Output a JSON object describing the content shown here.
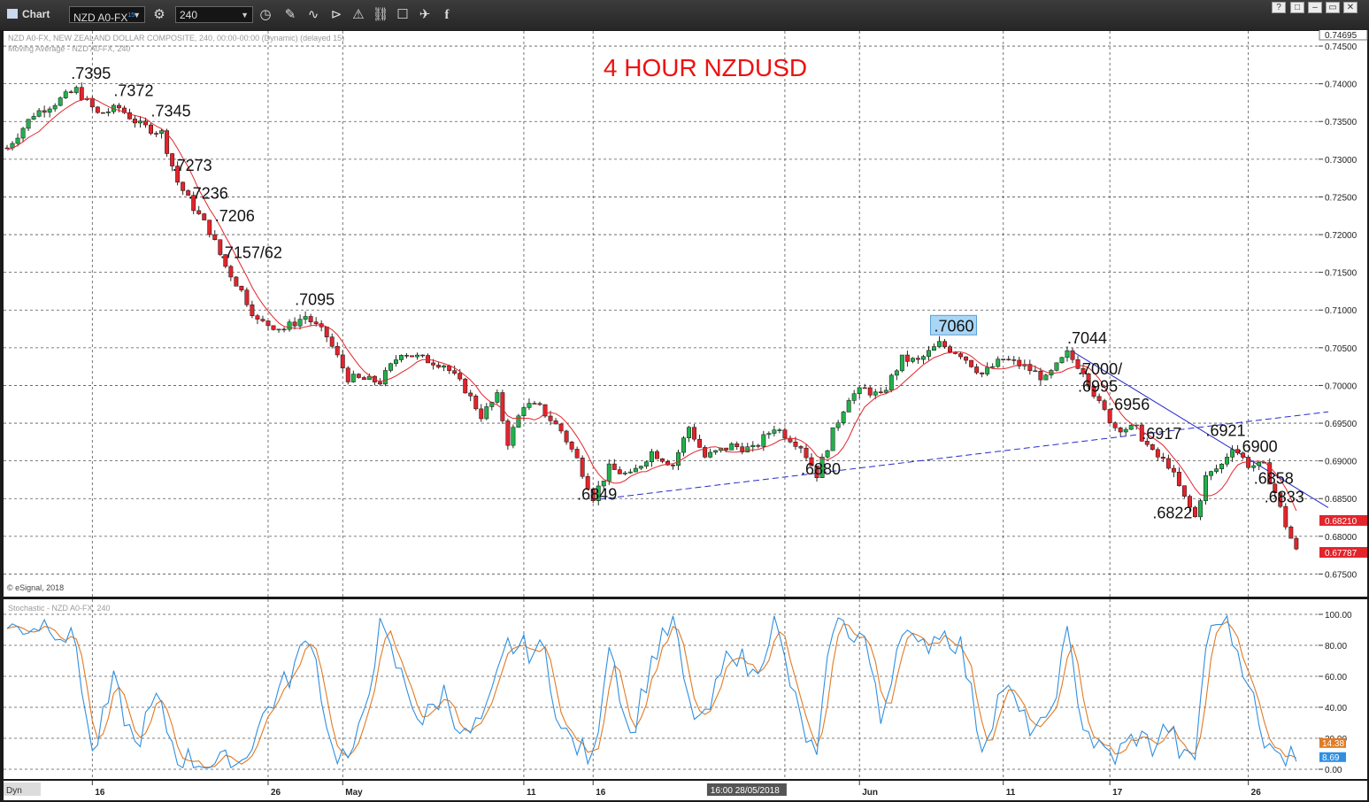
{
  "toolbar": {
    "app_label": "Chart",
    "symbol": "NZD A0-FX",
    "symbol_superscript": "15",
    "interval": "240",
    "window_buttons": [
      "?",
      "□",
      "–",
      "▭",
      "✕"
    ]
  },
  "colors": {
    "background": "#ffffff",
    "up_candle": "#22b14c",
    "down_candle": "#e2242b",
    "moving_average": "#e2242b",
    "trendline": "#2a2ad0",
    "stoch_k": "#2f8fe0",
    "stoch_d": "#e07b26",
    "title": "#ee1111",
    "highlight_box": "#a9d6f5"
  },
  "chart_data": [
    {
      "type": "candlestick",
      "title": "4 HOUR NZDUSD",
      "header_lines": [
        "NZD A0-FX, NEW ZEALAND DOLLAR COMPOSITE, 240, 00:00-00:00 (Dynamic) (delayed 15)",
        "Moving Average - NZD A0-FX, 240"
      ],
      "watermark": "© eSignal, 2018",
      "ylim": [
        0.672,
        0.747
      ],
      "y_ticks": [
        "0.74500",
        "0.74000",
        "0.73500",
        "0.73000",
        "0.72500",
        "0.72000",
        "0.71500",
        "0.71000",
        "0.70500",
        "0.70000",
        "0.69500",
        "0.69000",
        "0.68500",
        "0.68000",
        "0.67500"
      ],
      "price_tags": [
        {
          "label": "0.74695",
          "value": 0.74695,
          "style": "top"
        },
        {
          "label": "0.68210",
          "value": 0.6821,
          "style": "red"
        },
        {
          "label": "0.67787",
          "value": 0.67787,
          "style": "red"
        }
      ],
      "x_ticks": [
        {
          "label": "16",
          "index": 16
        },
        {
          "label": "26",
          "index": 49
        },
        {
          "label": "May",
          "index": 63
        },
        {
          "label": "11",
          "index": 97
        },
        {
          "label": "16",
          "index": 110
        },
        {
          "label": "Jun",
          "index": 160
        },
        {
          "label": "11",
          "index": 187
        },
        {
          "label": "17",
          "index": 207
        },
        {
          "label": "26",
          "index": 233
        }
      ],
      "x_tick_right": {
        "label": "16:00 28/05/2018",
        "index": 146
      },
      "n_bars": 242,
      "waypoints": [
        [
          0,
          0.7315
        ],
        [
          5,
          0.736
        ],
        [
          9,
          0.7375
        ],
        [
          13,
          0.7392
        ],
        [
          17,
          0.736
        ],
        [
          21,
          0.7368
        ],
        [
          25,
          0.7345
        ],
        [
          29,
          0.7335
        ],
        [
          32,
          0.727
        ],
        [
          35,
          0.7236
        ],
        [
          38,
          0.7205
        ],
        [
          41,
          0.7158
        ],
        [
          44,
          0.7125
        ],
        [
          47,
          0.7085
        ],
        [
          52,
          0.7075
        ],
        [
          56,
          0.7092
        ],
        [
          60,
          0.7065
        ],
        [
          64,
          0.701
        ],
        [
          70,
          0.7005
        ],
        [
          74,
          0.7045
        ],
        [
          78,
          0.7035
        ],
        [
          82,
          0.7028
        ],
        [
          86,
          0.6995
        ],
        [
          89,
          0.696
        ],
        [
          92,
          0.6985
        ],
        [
          94,
          0.6925
        ],
        [
          97,
          0.6975
        ],
        [
          100,
          0.697
        ],
        [
          104,
          0.694
        ],
        [
          107,
          0.6902
        ],
        [
          110,
          0.6852
        ],
        [
          113,
          0.689
        ],
        [
          117,
          0.688
        ],
        [
          121,
          0.6912
        ],
        [
          125,
          0.6895
        ],
        [
          128,
          0.6945
        ],
        [
          131,
          0.6905
        ],
        [
          136,
          0.692
        ],
        [
          140,
          0.6915
        ],
        [
          144,
          0.6945
        ],
        [
          149,
          0.692
        ],
        [
          152,
          0.6882
        ],
        [
          155,
          0.6938
        ],
        [
          158,
          0.6985
        ],
        [
          161,
          0.6995
        ],
        [
          164,
          0.6985
        ],
        [
          168,
          0.7035
        ],
        [
          171,
          0.7032
        ],
        [
          175,
          0.7055
        ],
        [
          179,
          0.7042
        ],
        [
          183,
          0.7015
        ],
        [
          187,
          0.7035
        ],
        [
          191,
          0.7025
        ],
        [
          195,
          0.7008
        ],
        [
          199,
          0.7042
        ],
        [
          202,
          0.702
        ],
        [
          205,
          0.6975
        ],
        [
          208,
          0.6945
        ],
        [
          212,
          0.6942
        ],
        [
          215,
          0.691
        ],
        [
          218,
          0.6895
        ],
        [
          221,
          0.685
        ],
        [
          223,
          0.6825
        ],
        [
          225,
          0.6878
        ],
        [
          228,
          0.6895
        ],
        [
          230,
          0.692
        ],
        [
          233,
          0.6895
        ],
        [
          236,
          0.6892
        ],
        [
          238,
          0.6858
        ],
        [
          240,
          0.6815
        ],
        [
          242,
          0.678
        ]
      ],
      "moving_average_period": 7,
      "annotations": [
        {
          "text": ".7395",
          "index": 13,
          "value": 0.7395
        },
        {
          "text": ".7372",
          "index": 21,
          "value": 0.7372
        },
        {
          "text": ".7345",
          "index": 28,
          "value": 0.7345
        },
        {
          "text": ".7273",
          "index": 32,
          "value": 0.7273
        },
        {
          "text": ".7236",
          "index": 35,
          "value": 0.7236
        },
        {
          "text": ".7206",
          "index": 40,
          "value": 0.7206
        },
        {
          "text": ".7157/62",
          "index": 41,
          "value": 0.7157
        },
        {
          "text": ".7095",
          "index": 55,
          "value": 0.7095
        },
        {
          "text": ".7060",
          "index": 175,
          "value": 0.706,
          "highlight": true
        },
        {
          "text": ".7044",
          "index": 200,
          "value": 0.7044
        },
        {
          "text": ".7000/",
          "index": 202,
          "value": 0.7003
        },
        {
          "text": ".6995",
          "index": 202,
          "value": 0.698
        },
        {
          "text": ".6956",
          "index": 208,
          "value": 0.6956
        },
        {
          "text": ".6917",
          "index": 214,
          "value": 0.6917
        },
        {
          "text": ".6921",
          "index": 226,
          "value": 0.6921
        },
        {
          "text": ".6900",
          "index": 232,
          "value": 0.69
        },
        {
          "text": ".6858",
          "index": 235,
          "value": 0.6858
        },
        {
          "text": ".6833",
          "index": 237,
          "value": 0.6833
        },
        {
          "text": ".6822",
          "index": 216,
          "value": 0.6812
        },
        {
          "text": ".6880",
          "index": 150,
          "value": 0.687
        },
        {
          "text": ".6849",
          "index": 108,
          "value": 0.6837
        }
      ],
      "trendlines": [
        {
          "dash": true,
          "from": [
            111,
            0.6849
          ],
          "to": [
            248,
            0.6965
          ]
        },
        {
          "dash": false,
          "from": [
            200,
            0.7045
          ],
          "to": [
            248,
            0.6838
          ]
        }
      ]
    },
    {
      "type": "line",
      "title": "Stochastic - NZD A0-FX, 240",
      "ylim": [
        0,
        100
      ],
      "y_ticks": [
        "100.00",
        "80.00",
        "60.00",
        "40.00",
        "20.00",
        "0.00"
      ],
      "value_tags": [
        {
          "label": "14.38",
          "value": 14.38,
          "series": "%D"
        },
        {
          "label": "8.69",
          "value": 8.69,
          "series": "%K"
        }
      ],
      "k_waypoints": [
        [
          0,
          90
        ],
        [
          8,
          95
        ],
        [
          13,
          80
        ],
        [
          16,
          8
        ],
        [
          20,
          55
        ],
        [
          24,
          15
        ],
        [
          28,
          45
        ],
        [
          32,
          8
        ],
        [
          38,
          3
        ],
        [
          44,
          5
        ],
        [
          49,
          40
        ],
        [
          53,
          60
        ],
        [
          57,
          88
        ],
        [
          61,
          12
        ],
        [
          65,
          6
        ],
        [
          70,
          90
        ],
        [
          74,
          60
        ],
        [
          78,
          30
        ],
        [
          82,
          50
        ],
        [
          86,
          20
        ],
        [
          90,
          35
        ],
        [
          94,
          80
        ],
        [
          97,
          78
        ],
        [
          101,
          75
        ],
        [
          104,
          25
        ],
        [
          107,
          15
        ],
        [
          110,
          5
        ],
        [
          113,
          85
        ],
        [
          117,
          20
        ],
        [
          121,
          70
        ],
        [
          125,
          95
        ],
        [
          128,
          40
        ],
        [
          131,
          30
        ],
        [
          136,
          80
        ],
        [
          140,
          60
        ],
        [
          144,
          95
        ],
        [
          149,
          30
        ],
        [
          152,
          5
        ],
        [
          155,
          95
        ],
        [
          158,
          90
        ],
        [
          161,
          85
        ],
        [
          164,
          30
        ],
        [
          168,
          95
        ],
        [
          171,
          75
        ],
        [
          175,
          90
        ],
        [
          179,
          80
        ],
        [
          183,
          15
        ],
        [
          187,
          55
        ],
        [
          191,
          30
        ],
        [
          195,
          25
        ],
        [
          199,
          85
        ],
        [
          202,
          30
        ],
        [
          205,
          12
        ],
        [
          208,
          8
        ],
        [
          212,
          22
        ],
        [
          215,
          15
        ],
        [
          218,
          28
        ],
        [
          221,
          5
        ],
        [
          223,
          8
        ],
        [
          225,
          80
        ],
        [
          228,
          100
        ],
        [
          230,
          85
        ],
        [
          233,
          60
        ],
        [
          236,
          10
        ],
        [
          238,
          20
        ],
        [
          240,
          8
        ],
        [
          242,
          9
        ]
      ]
    }
  ]
}
